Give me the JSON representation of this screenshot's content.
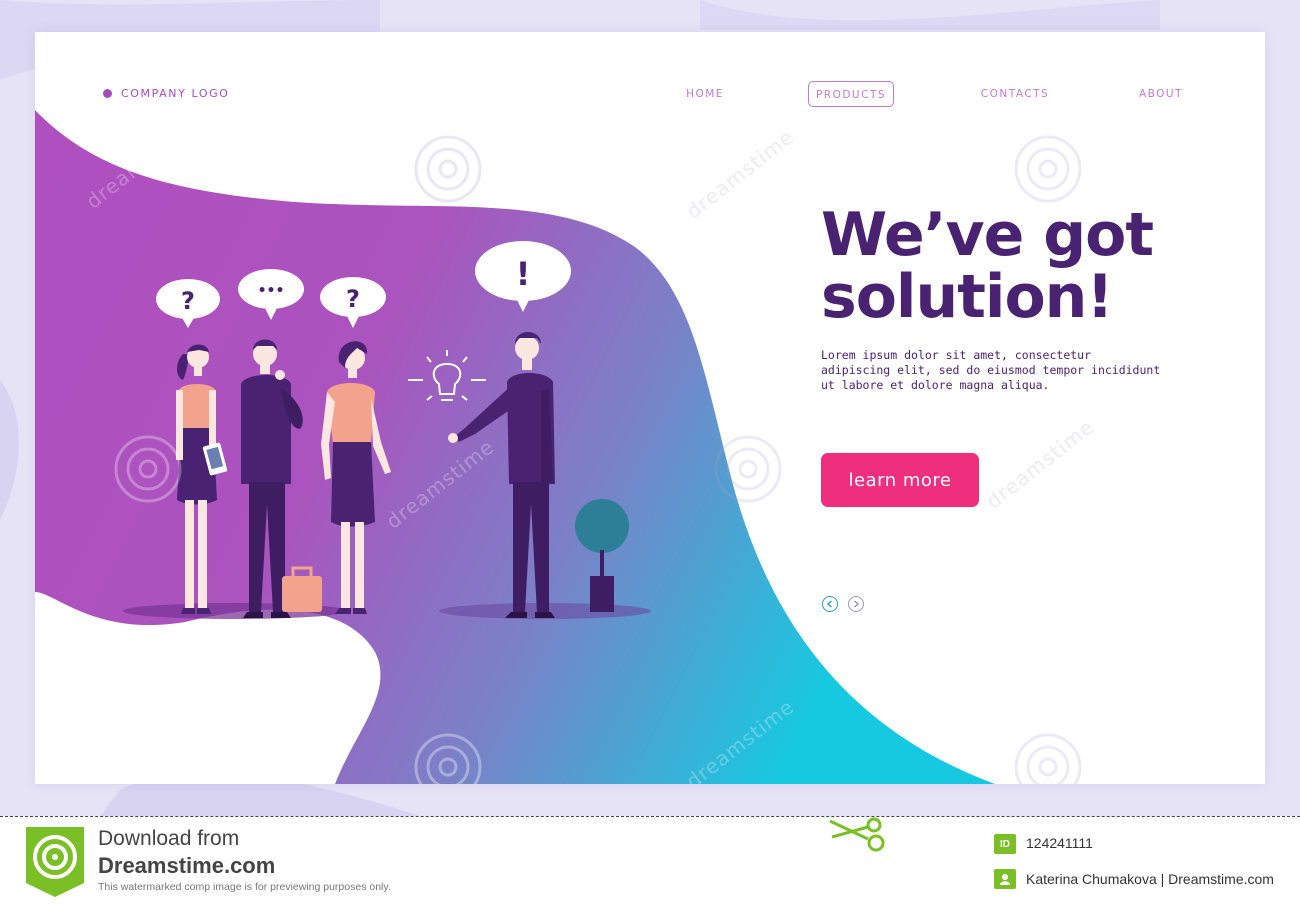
{
  "header": {
    "logo_text": "COMPANY LOGO",
    "nav": [
      {
        "label": "HOME",
        "active": false
      },
      {
        "label": "PRODUCTS",
        "active": true
      },
      {
        "label": "CONTACTS",
        "active": false
      },
      {
        "label": "ABOUT",
        "active": false
      }
    ]
  },
  "hero": {
    "headline_line1": "We’ve got",
    "headline_line2": "solution!",
    "body_line1": "Lorem ipsum dolor sit amet, consectetur",
    "body_line2": "adipiscing elit, sed do eiusmod tempor incididunt",
    "body_line3": "ut labore et dolore magna aliqua.",
    "cta_label": "learn more"
  },
  "illustration": {
    "bubbles": [
      "?",
      "•••",
      "?",
      "!"
    ]
  },
  "watermark": {
    "text": "dreamstime"
  },
  "footer": {
    "download_text": "Download from",
    "site_name": "Dreamstime.com",
    "note": "This watermarked comp image is for previewing purposes only.",
    "id_badge": "ID",
    "image_id": "124241111",
    "author": "Katerina Chumakova | Dreamstime.com"
  },
  "colors": {
    "brand_purple": "#4a2272",
    "gradient_start": "#b04fc0",
    "gradient_end": "#17c9e0",
    "cta": "#ef2f7d",
    "nav_text": "#c07ad2",
    "page_bg": "#e6e3f7",
    "footer_green": "#7bbf26"
  },
  "icons": [
    "dot-icon",
    "lightbulb-icon",
    "chevron-left-icon",
    "chevron-right-icon",
    "plant-icon",
    "briefcase-icon",
    "phone-icon",
    "scissors-icon",
    "dreamstime-logo-icon"
  ]
}
